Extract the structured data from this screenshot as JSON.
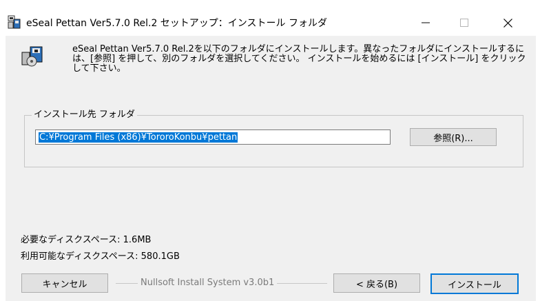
{
  "window": {
    "title": "eSeal Pettan Ver5.7.0 Rel.2 セットアップ：インストール フォルダ",
    "controls": {
      "minimize": "—",
      "maximize": "☐",
      "close": "✕"
    },
    "icon": "installer-app-icon"
  },
  "header": {
    "icon": "installer-disk-icon",
    "message": "eSeal Pettan Ver5.7.0 Rel.2を以下のフォルダにインストールします。異なったフォルダにインストールするには、[参照] を押して、別のフォルダを選択してください。 インストールを始めるには [インストール] をクリックして下さい。"
  },
  "destination": {
    "group_label": "インストール先 フォルダ",
    "path": "C:¥Program Files (x86)¥TororoKonbu¥pettan",
    "browse_label": "参照(R)..."
  },
  "space": {
    "required": "必要なディスクスペース: 1.6MB",
    "available": "利用可能なディスクスペース: 580.1GB"
  },
  "footer": {
    "cancel_label": "キャンセル",
    "branding": "Nullsoft Install System v3.0b1",
    "back_label": "< 戻る(B)",
    "install_label": "インストール"
  },
  "colors": {
    "selection": "#0078d7",
    "default_button_border": "#0078d7",
    "dialog_background": "#f0f0f0"
  }
}
